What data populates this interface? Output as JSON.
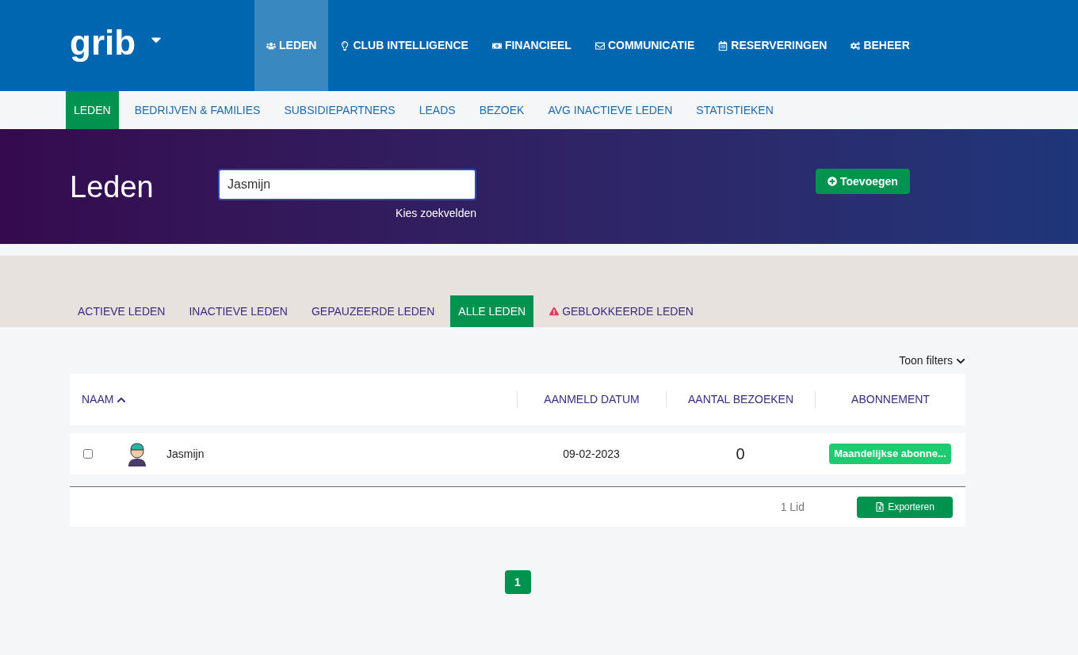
{
  "logo": {
    "text": "grib"
  },
  "main_nav": [
    {
      "label": "LEDEN",
      "selected": true
    },
    {
      "label": "CLUB INTELLIGENCE",
      "selected": false
    },
    {
      "label": "FINANCIEEL",
      "selected": false
    },
    {
      "label": "COMMUNICATIE",
      "selected": false
    },
    {
      "label": "RESERVERINGEN",
      "selected": false
    },
    {
      "label": "BEHEER",
      "selected": false
    }
  ],
  "sub_nav": [
    {
      "label": "LEDEN",
      "selected": true
    },
    {
      "label": "BEDRIJVEN & FAMILIES",
      "selected": false
    },
    {
      "label": "SUBSIDIEPARTNERS",
      "selected": false
    },
    {
      "label": "LEADS",
      "selected": false
    },
    {
      "label": "BEZOEK",
      "selected": false
    },
    {
      "label": "AVG INACTIEVE LEDEN",
      "selected": false
    },
    {
      "label": "STATISTIEKEN",
      "selected": false
    }
  ],
  "header": {
    "title": "Leden",
    "search": {
      "value": "Jasmijn"
    },
    "search_fields_link": "Kies zoekvelden",
    "add_button": "Toevoegen"
  },
  "member_tabs": [
    {
      "label": "ACTIEVE LEDEN",
      "selected": false,
      "kind": "plain"
    },
    {
      "label": "INACTIEVE LEDEN",
      "selected": false,
      "kind": "plain"
    },
    {
      "label": "GEPAUZEERDE LEDEN",
      "selected": false,
      "kind": "plain"
    },
    {
      "label": "ALLE LEDEN",
      "selected": true,
      "kind": "plain"
    },
    {
      "label": "GEBLOKKEERDE LEDEN",
      "selected": false,
      "kind": "warning"
    }
  ],
  "filters_toggle": "Toon filters",
  "table": {
    "columns": [
      "NAAM",
      "AANMELD DATUM",
      "AANTAL BEZOEKEN",
      "ABONNEMENT"
    ],
    "rows": [
      {
        "checked": false,
        "name": "Jasmijn",
        "date": "09-02-2023",
        "visits": "0",
        "subscription": "Maandelijkse abonne..."
      }
    ],
    "count": "1 Lid",
    "export_button": "Exporteren"
  },
  "pagination": [
    {
      "label": "1",
      "selected": true
    }
  ]
}
